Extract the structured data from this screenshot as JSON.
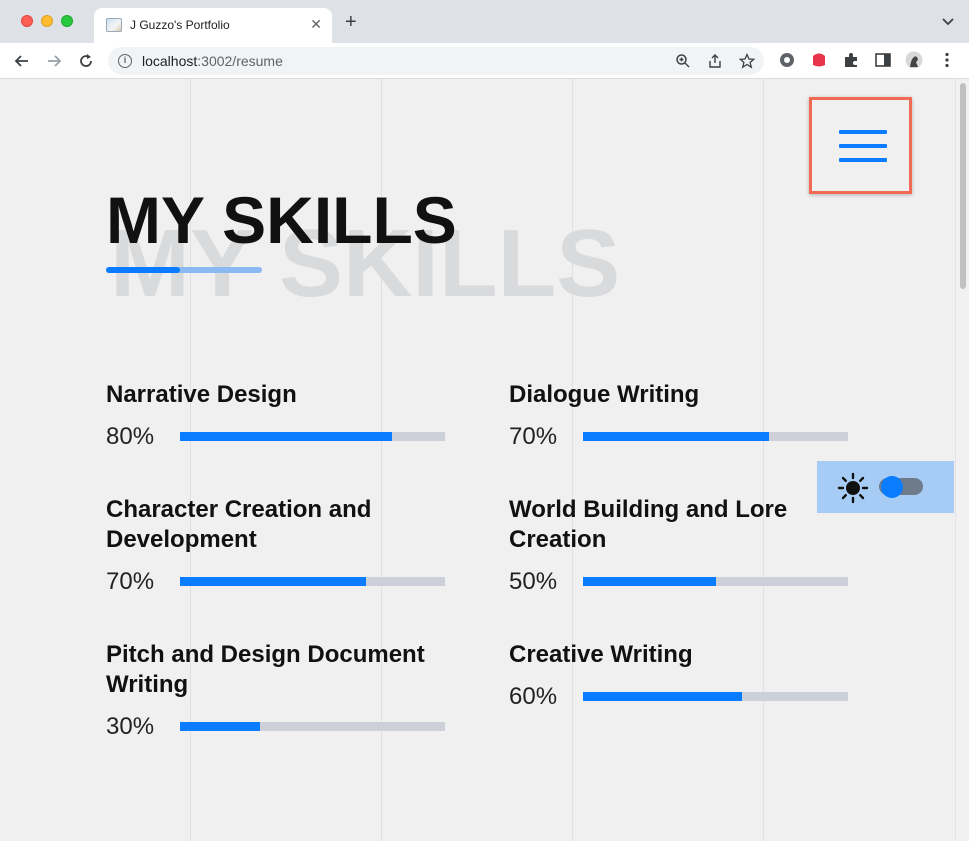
{
  "browser": {
    "tab_title": "J Guzzo's Portfolio",
    "tab_close": "✕",
    "new_tab": "+",
    "url_host": "localhost",
    "url_path": ":3002/resume"
  },
  "page": {
    "menu_icon": "hamburger-menu-icon",
    "title": "MY SKILLS",
    "title_background": "MY SKILLS",
    "skills": [
      {
        "name": "Narrative Design",
        "percent_label": "80%",
        "value": 80
      },
      {
        "name": "Dialogue Writing",
        "percent_label": "70%",
        "value": 70
      },
      {
        "name": "Character Creation and Development",
        "percent_label": "70%",
        "value": 70
      },
      {
        "name": "World Building and Lore Creation",
        "percent_label": "50%",
        "value": 50
      },
      {
        "name": "Pitch and Design Document Writing",
        "percent_label": "30%",
        "value": 30
      },
      {
        "name": "Creative Writing",
        "percent_label": "60%",
        "value": 60
      }
    ],
    "theme_toggle": {
      "icon": "sun-icon",
      "state": "off"
    }
  },
  "colors": {
    "accent": "#0a7cff",
    "track": "#cdd0d8",
    "menu_border": "#f26a53",
    "toggle_bg": "#a6ccf5"
  }
}
